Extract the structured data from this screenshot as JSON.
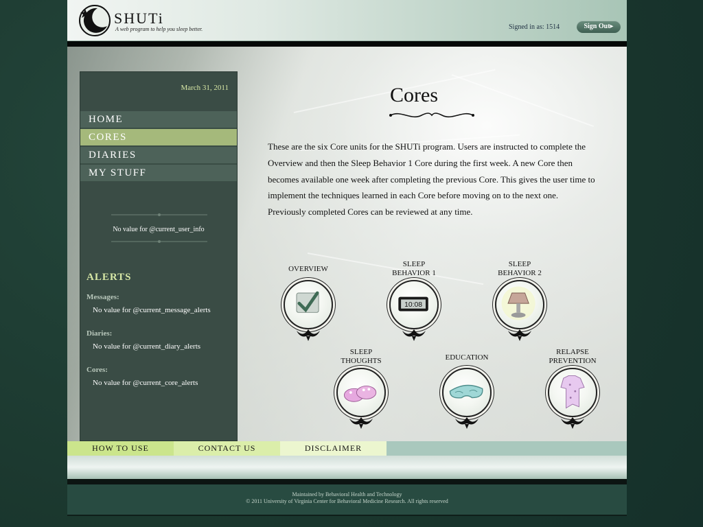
{
  "header": {
    "logo_name": "SHUTi",
    "tagline": "A web program to help you sleep better.",
    "signed_in_label": "Signed in as: 1514",
    "signout_label": "Sign Out▸"
  },
  "sidebar": {
    "date": "March 31, 2011",
    "nav": [
      "HOME",
      "CORES",
      "DIARIES",
      "MY STUFF"
    ],
    "active_nav": "CORES",
    "current_user_info": "No value for @current_user_info",
    "alerts": {
      "heading": "ALERTS",
      "messages_label": "Messages:",
      "messages_value": "No value for @current_message_alerts",
      "diaries_label": "Diaries:",
      "diaries_value": "No value for @current_diary_alerts",
      "cores_label": "Cores:",
      "cores_value": "No value for @current_core_alerts"
    }
  },
  "content": {
    "title": "Cores",
    "intro": "These are the six Core units for the SHUTi program. Users are instructed to complete the Overview and then the Sleep Behavior 1 Core during the first week. A new Core then becomes available one week after completing the previous Core. This gives the user time to implement the techniques learned in each Core before moving on to the next one. Previously completed Cores can be reviewed at any time.",
    "cores": [
      {
        "label_line1": "OVERVIEW",
        "label_line2": "",
        "icon": "checkmark-icon"
      },
      {
        "label_line1": "SLEEP",
        "label_line2": "BEHAVIOR 1",
        "icon": "alarm-clock-icon",
        "clock_text": "10:08"
      },
      {
        "label_line1": "SLEEP",
        "label_line2": "BEHAVIOR 2",
        "icon": "lamp-icon"
      },
      {
        "label_line1": "SLEEP",
        "label_line2": "THOUGHTS",
        "icon": "slippers-icon"
      },
      {
        "label_line1": "EDUCATION",
        "label_line2": "",
        "icon": "sleep-mask-icon"
      },
      {
        "label_line1": "RELAPSE",
        "label_line2": "PREVENTION",
        "icon": "pajamas-icon"
      }
    ]
  },
  "footer_nav": [
    "HOW TO USE",
    "CONTACT US",
    "DISCLAIMER"
  ],
  "footer": {
    "line1": "Maintained by Behavioral Health and Technology",
    "line2": "© 2011 University of Virginia Center for Behavioral Medicine Research. All rights reserved"
  },
  "colors": {
    "sidebar_bg": "#3a4c45",
    "nav_active": "#a5b97b",
    "accent_text": "#d8e8a6",
    "footer_bg": "#284b41"
  }
}
